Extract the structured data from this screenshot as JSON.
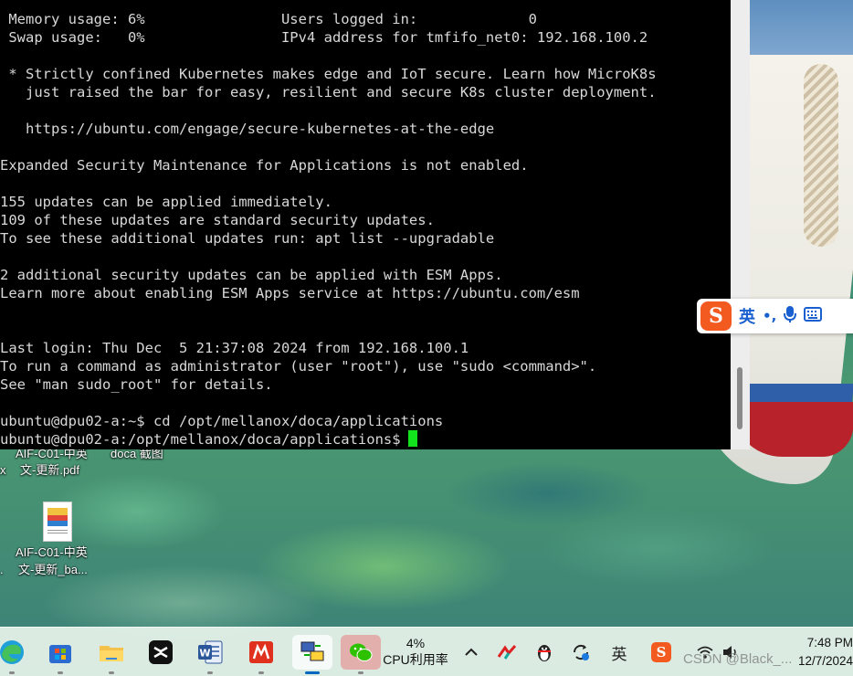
{
  "terminal": {
    "lines": [
      " Memory usage: 6%                Users logged in:             0",
      " Swap usage:   0%                IPv4 address for tmfifo_net0: 192.168.100.2",
      "",
      " * Strictly confined Kubernetes makes edge and IoT secure. Learn how MicroK8s",
      "   just raised the bar for easy, resilient and secure K8s cluster deployment.",
      "",
      "   https://ubuntu.com/engage/secure-kubernetes-at-the-edge",
      "",
      "Expanded Security Maintenance for Applications is not enabled.",
      "",
      "155 updates can be applied immediately.",
      "109 of these updates are standard security updates.",
      "To see these additional updates run: apt list --upgradable",
      "",
      "2 additional security updates can be applied with ESM Apps.",
      "Learn more about enabling ESM Apps service at https://ubuntu.com/esm",
      "",
      "",
      "Last login: Thu Dec  5 21:37:08 2024 from 192.168.100.1",
      "To run a command as administrator (user \"root\"), use \"sudo <command>\".",
      "See \"man sudo_root\" for details.",
      "",
      "ubuntu@dpu02-a:~$ cd /opt/mellanox/doca/applications"
    ],
    "prompt": "ubuntu@dpu02-a:/opt/mellanox/doca/applications$",
    "cursor_color": "#12e21e"
  },
  "ime": {
    "logo": "S",
    "mode_label": "英",
    "punct": "•,",
    "mic_icon": "microphone-icon",
    "keyboard_icon": "keyboard-icon"
  },
  "desktop": {
    "icon1": {
      "line1": "AIF-C01-中英",
      "line2": "文-更新.pdf",
      "extra": "doca 截图",
      "left_clip": "x"
    },
    "icon2": {
      "line1": "AIF-C01-中英",
      "line2": "文-更新_ba...",
      "left_clip": "."
    }
  },
  "taskbar": {
    "apps": [
      {
        "name": "edge",
        "icon": "edge-icon"
      },
      {
        "name": "store",
        "icon": "store-icon"
      },
      {
        "name": "file-explorer",
        "icon": "folder-icon"
      },
      {
        "name": "capcut",
        "icon": "capcut-icon"
      },
      {
        "name": "word",
        "icon": "word-icon"
      },
      {
        "name": "pdf-reader",
        "icon": "pdf-icon"
      },
      {
        "name": "network-terminal",
        "icon": "network-icon"
      },
      {
        "name": "wechat",
        "icon": "wechat-icon"
      }
    ],
    "cpu_percent": "4%",
    "cpu_label": "CPU利用率",
    "tray": {
      "ime_char": "英",
      "sogou": "S"
    },
    "time": "7:48 PM",
    "date": "12/7/2024"
  },
  "watermark": "CSDN @Black_...",
  "colors": {
    "terminal_bg": "#000000",
    "terminal_fg": "#d8d8d8",
    "accent": "#0067c0"
  }
}
